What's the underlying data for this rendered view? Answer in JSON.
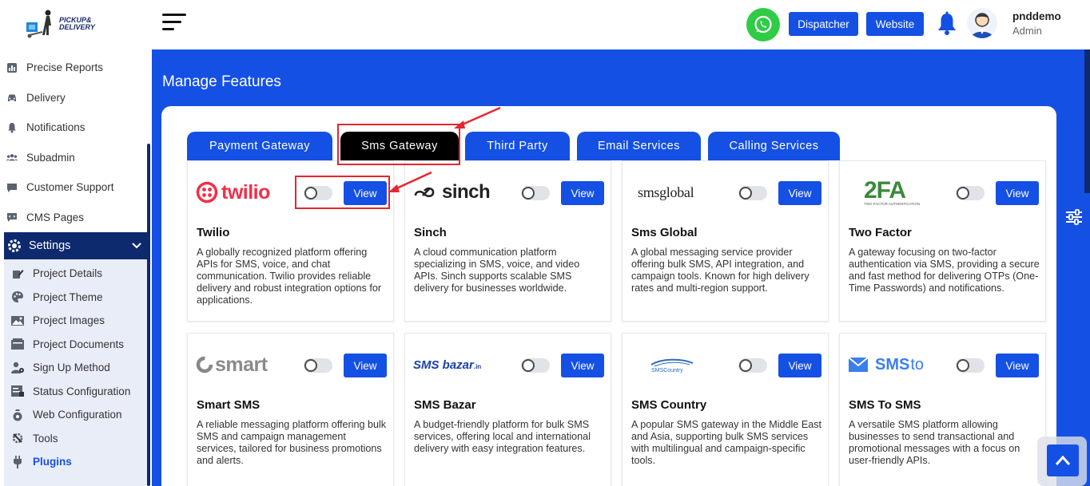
{
  "logo": {
    "text_line1": "PICKUP&",
    "text_line2": "DELIVERY"
  },
  "sidebar": {
    "items": [
      {
        "label": "Precise Reports",
        "icon": "report-icon"
      },
      {
        "label": "Delivery",
        "icon": "car-icon"
      },
      {
        "label": "Notifications",
        "icon": "bell-icon"
      },
      {
        "label": "Subadmin",
        "icon": "users-icon"
      },
      {
        "label": "Customer Support",
        "icon": "chat-icon"
      },
      {
        "label": "CMS Pages",
        "icon": "code-icon"
      }
    ],
    "active": {
      "label": "Settings",
      "icon": "gear-icon"
    },
    "sub_items": [
      {
        "label": "Project Details",
        "icon": "pencil-icon"
      },
      {
        "label": "Project Theme",
        "icon": "palette-icon"
      },
      {
        "label": "Project Images",
        "icon": "image-icon"
      },
      {
        "label": "Project Documents",
        "icon": "documents-icon"
      },
      {
        "label": "Sign Up Method",
        "icon": "user-gear-icon"
      },
      {
        "label": "Status Configuration",
        "icon": "status-icon"
      },
      {
        "label": "Web Configuration",
        "icon": "bag-icon"
      },
      {
        "label": "Tools",
        "icon": "tools-icon"
      },
      {
        "label": "Plugins",
        "icon": "plug-icon"
      }
    ]
  },
  "header": {
    "dispatcher_label": "Dispatcher",
    "website_label": "Website",
    "user_name": "pnddemo",
    "user_role": "Admin"
  },
  "page": {
    "title": "Manage Features"
  },
  "tabs": [
    {
      "label": "Payment Gateway"
    },
    {
      "label": "Sms Gateway"
    },
    {
      "label": "Third Party"
    },
    {
      "label": "Email Services"
    },
    {
      "label": "Calling Services"
    }
  ],
  "active_tab": "Sms Gateway",
  "view_label": "View",
  "providers": [
    {
      "logo_text": "twilio",
      "name": "Twilio",
      "desc": "A globally recognized platform offering APIs for SMS, voice, and chat communication. Twilio provides reliable delivery and robust integration options for applications."
    },
    {
      "logo_text": "sinch",
      "name": "Sinch",
      "desc": "A cloud communication platform specializing in SMS, voice, and video APIs. Sinch supports scalable SMS delivery for businesses worldwide."
    },
    {
      "logo_text": "smsglobal",
      "name": "Sms Global",
      "desc": "A global messaging service provider offering bulk SMS, API integration, and campaign tools. Known for high delivery rates and multi-region support."
    },
    {
      "logo_text": "2FA",
      "logo_sub": "TWO FACTOR AUTHENTICATION",
      "name": "Two Factor",
      "desc": "A gateway focusing on two-factor authentication via SMS, providing a secure and fast method for delivering OTPs (One-Time Passwords) and notifications."
    },
    {
      "logo_text": "smart",
      "name": "Smart SMS",
      "desc": "A reliable messaging platform offering bulk SMS and campaign management services, tailored for business promotions and alerts."
    },
    {
      "logo_text": "SMS bazar",
      "logo_sub": ".in",
      "name": "SMS Bazar",
      "desc": "A budget-friendly platform for bulk SMS services, offering local and international delivery with easy integration features."
    },
    {
      "logo_text": "SMSCountry",
      "name": "SMS Country",
      "desc": "A popular SMS gateway in the Middle East and Asia, supporting bulk SMS services with multilingual and campaign-specific tools."
    },
    {
      "logo_text": "SMS",
      "logo_sub": "to",
      "name": "SMS To SMS",
      "desc": "A versatile SMS platform allowing businesses to send transactional and promotional messages with a focus on user-friendly APIs."
    }
  ],
  "colors": {
    "primary": "#1550e4",
    "navy": "#0e2a6e",
    "active_tab": "#000000",
    "highlight": "#e5262f",
    "whatsapp": "#2fcc45",
    "twilio": "#f22f46"
  }
}
